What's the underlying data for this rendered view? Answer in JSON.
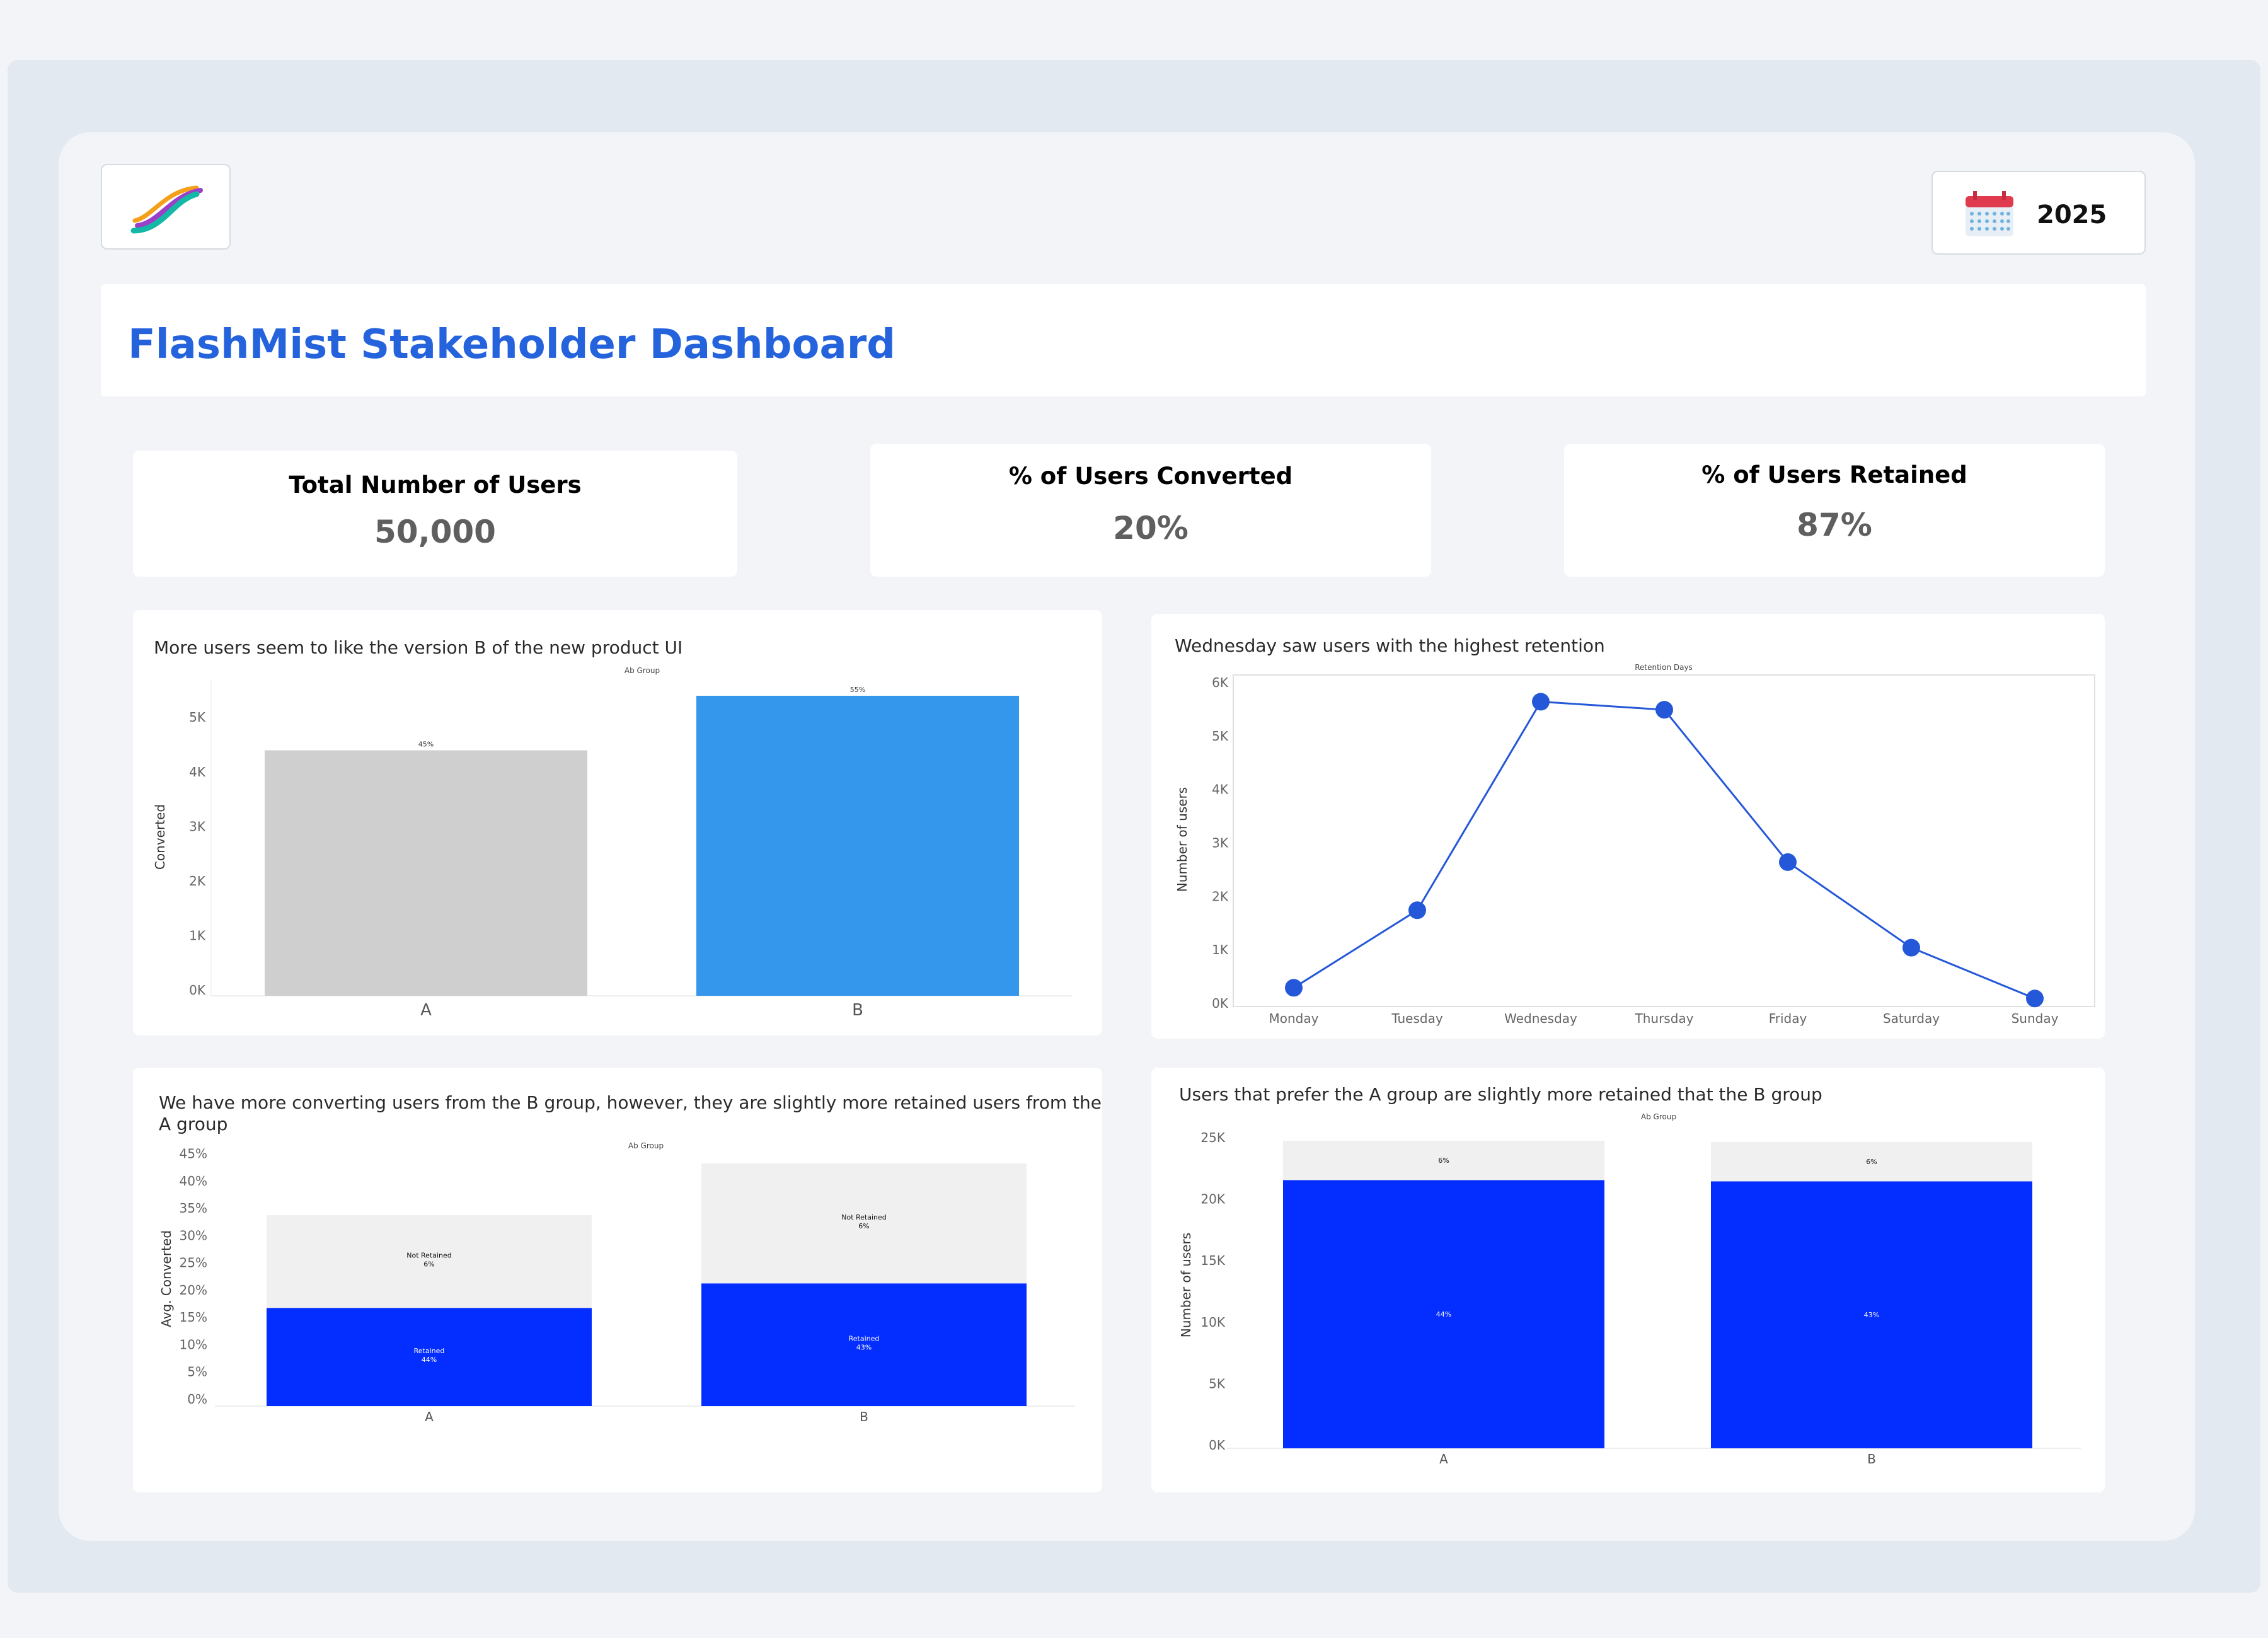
{
  "app": {
    "title": "FlashMist Stakeholder Dashboard",
    "year": "2025"
  },
  "kpis": [
    {
      "label": "Total Number of Users",
      "value": "50,000"
    },
    {
      "label": "% of Users Converted",
      "value": "20%"
    },
    {
      "label": "% of Users Retained",
      "value": "87%"
    }
  ],
  "colors": {
    "accent": "#2563dd",
    "groupA": "#cfcfcf",
    "groupB": "#3497eb",
    "retained": "#042dff",
    "not_retained": "#f0f0f0",
    "line": "#2558d8"
  },
  "panels": {
    "conversion": {
      "title": "More users seem to like the version B of the new product UI"
    },
    "retention_days": {
      "title": "Wednesday saw users with the highest retention"
    },
    "converted_retained": {
      "title_line1": "We have more converting users from the B group, however, they are slightly more retained users from the",
      "title_line2": "A group"
    },
    "group_retention": {
      "title": "Users that prefer the A group are slightly more retained that the B group"
    }
  },
  "chart_data": [
    {
      "type": "bar",
      "legend_title": "Ab Group",
      "ylabel": "Converted",
      "categories": [
        "A",
        "B"
      ],
      "values": [
        4500,
        5500
      ],
      "data_labels": [
        "45%",
        "55%"
      ],
      "yticks": [
        "0K",
        "1K",
        "2K",
        "3K",
        "4K",
        "5K"
      ],
      "ylim": [
        0,
        5800
      ]
    },
    {
      "type": "line",
      "legend_title": "Retention Days",
      "ylabel": "Number of users",
      "categories": [
        "Monday",
        "Tuesday",
        "Wednesday",
        "Thursday",
        "Friday",
        "Saturday",
        "Sunday"
      ],
      "values": [
        350,
        1800,
        5700,
        5550,
        2700,
        1100,
        150
      ],
      "yticks": [
        "0K",
        "1K",
        "2K",
        "3K",
        "4K",
        "5K",
        "6K"
      ],
      "ylim": [
        0,
        6200
      ]
    },
    {
      "type": "bar",
      "stacked": true,
      "legend_title": "Ab Group",
      "ylabel": "Avg. Converted",
      "categories": [
        "A",
        "B"
      ],
      "series": [
        {
          "name": "Retained",
          "values": [
            18,
            22.5
          ],
          "labels": [
            "Retained\n44%",
            "Retained\n43%"
          ]
        },
        {
          "name": "Not Retained",
          "values": [
            17,
            22
          ],
          "labels": [
            "Not Retained\n6%",
            "Not Retained\n6%"
          ]
        }
      ],
      "yticks": [
        "0%",
        "5%",
        "10%",
        "15%",
        "20%",
        "25%",
        "30%",
        "35%",
        "40%",
        "45%"
      ],
      "ylim": [
        0,
        46
      ]
    },
    {
      "type": "bar",
      "stacked": true,
      "legend_title": "Ab Group",
      "ylabel": "Number of users",
      "categories": [
        "A",
        "B"
      ],
      "series": [
        {
          "name": "Retained",
          "values": [
            21800,
            21700
          ],
          "labels": [
            "44%",
            "43%"
          ]
        },
        {
          "name": "Not Retained",
          "values": [
            3200,
            3200
          ],
          "labels": [
            "6%",
            "6%"
          ]
        }
      ],
      "yticks": [
        "0K",
        "5K",
        "10K",
        "15K",
        "20K",
        "25K"
      ],
      "ylim": [
        0,
        25000
      ]
    }
  ]
}
